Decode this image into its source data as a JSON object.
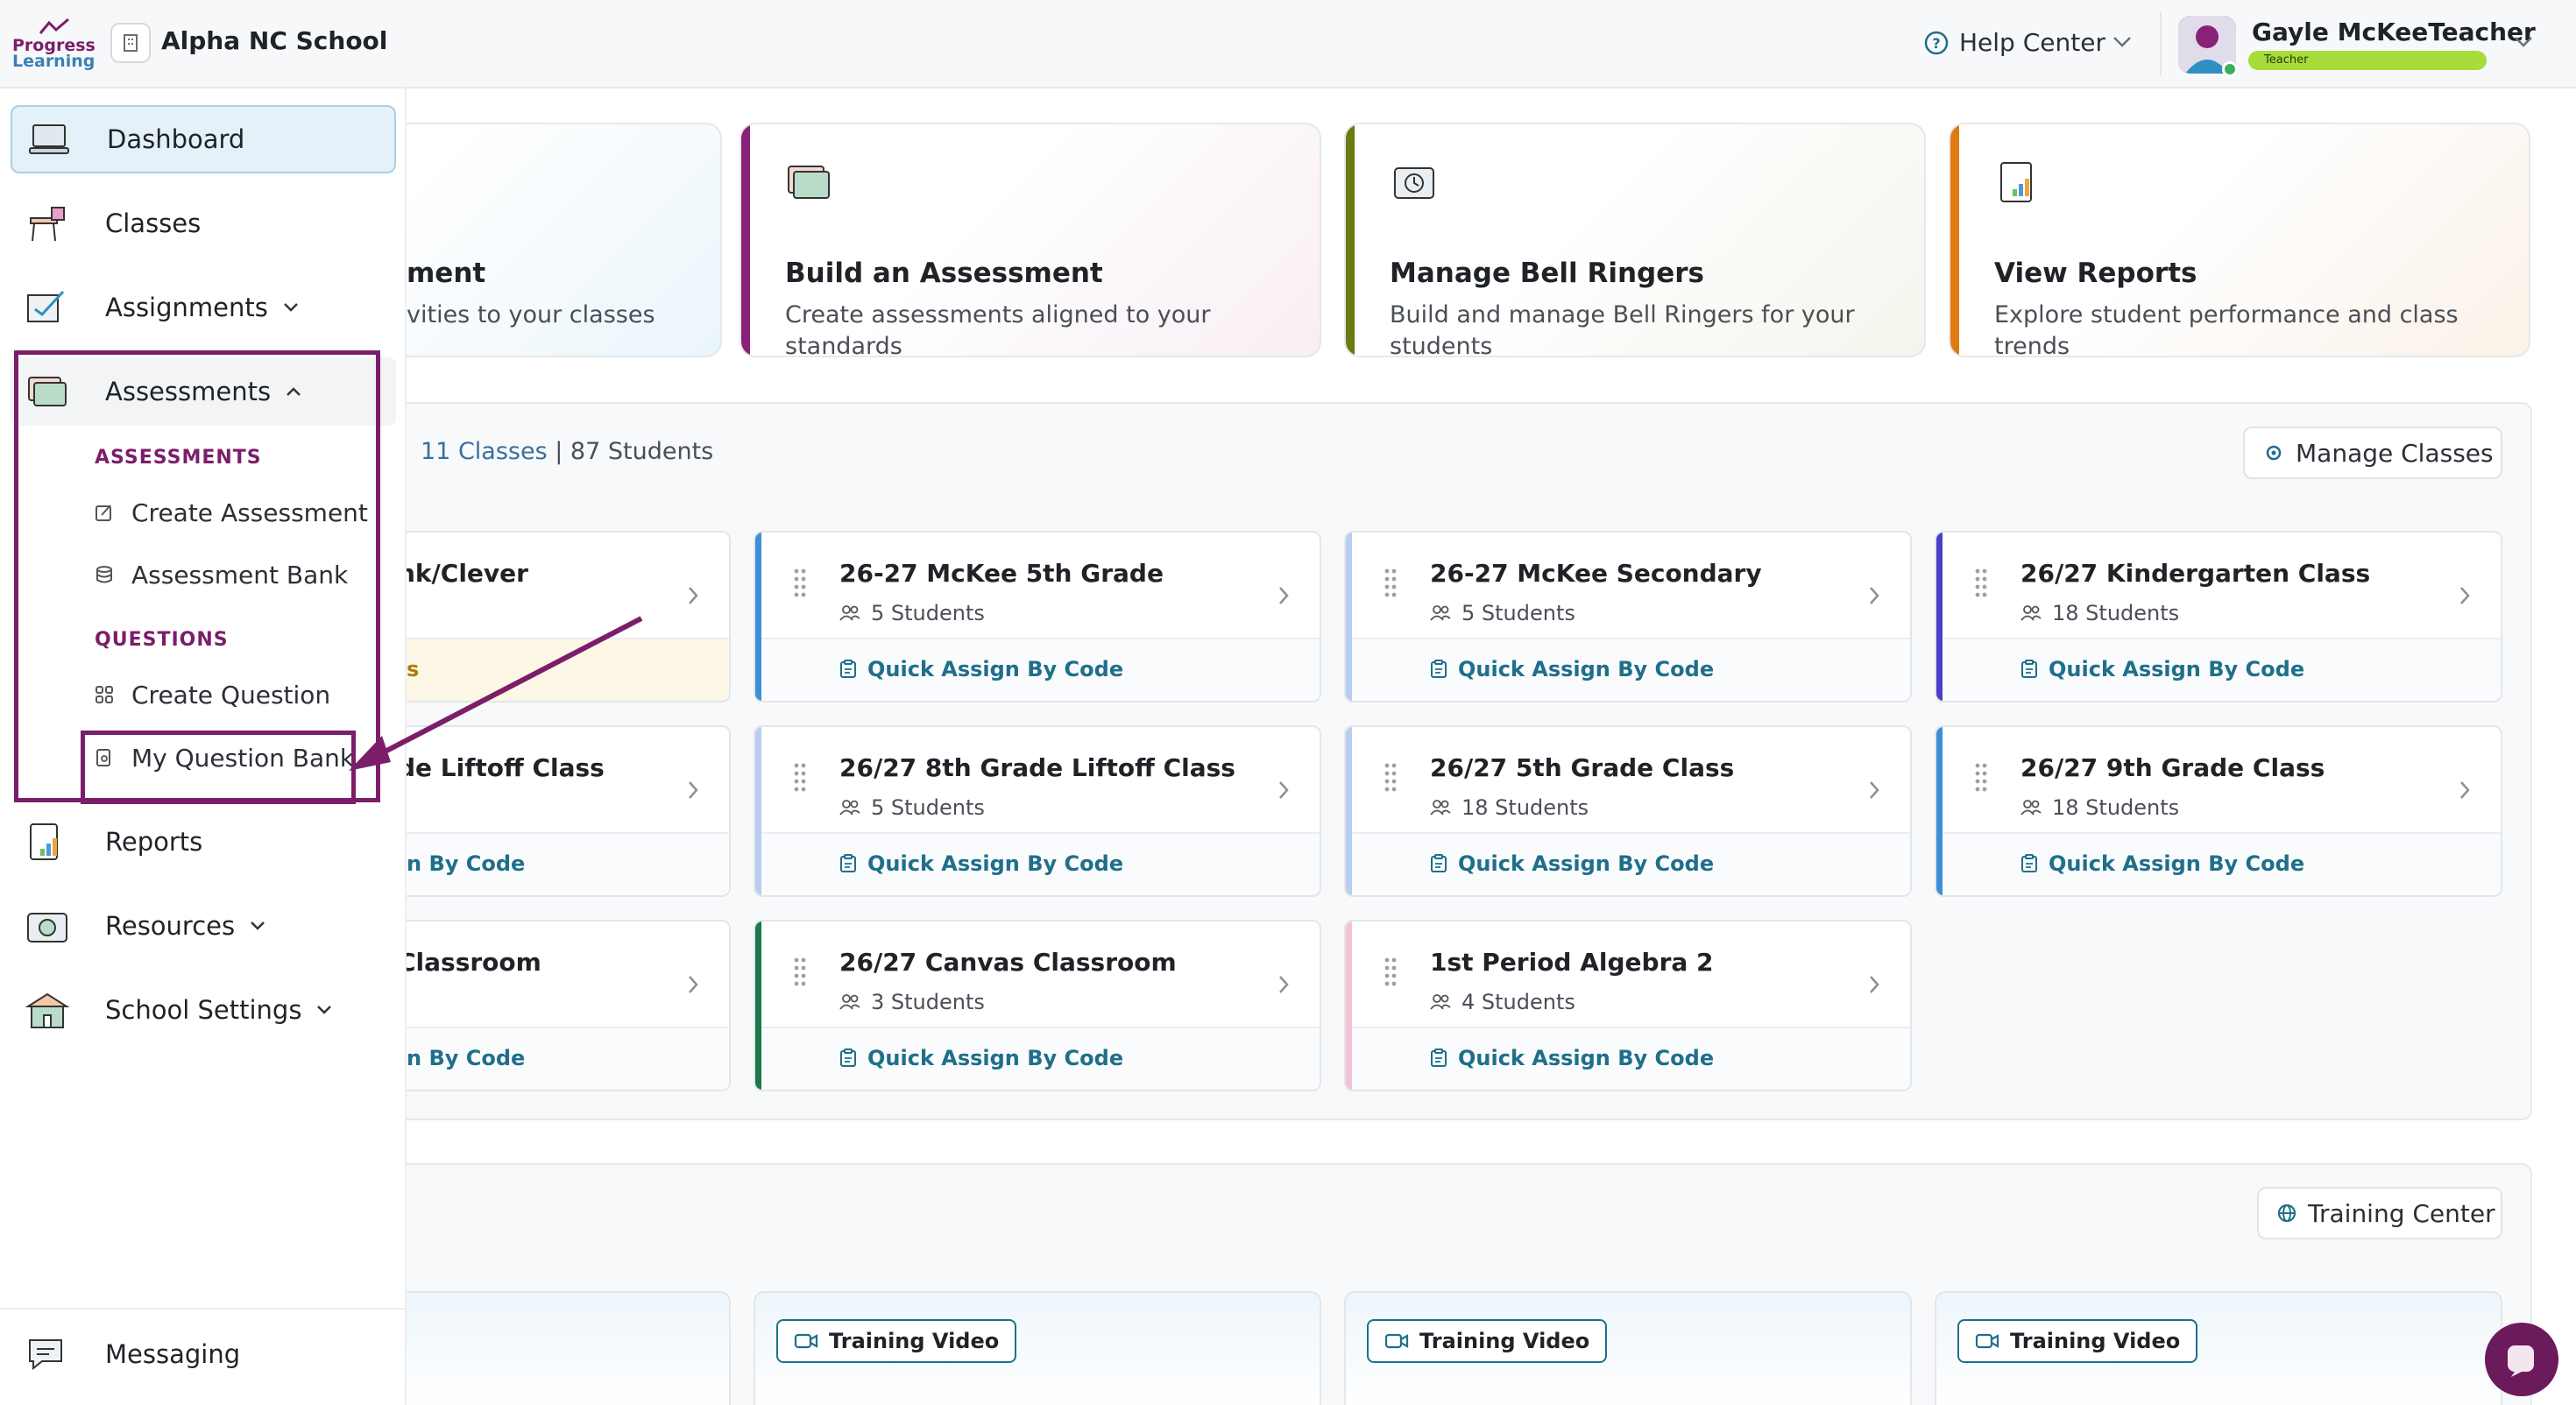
{
  "brand": {
    "logo_line1": "Progress",
    "logo_line2": "Learning",
    "school_name": "Alpha NC School"
  },
  "header": {
    "help_label": "Help Center",
    "user_name": "Gayle McKeeTeacher",
    "user_role": "Teacher"
  },
  "sidebar": {
    "items": [
      {
        "label": "Dashboard"
      },
      {
        "label": "Classes"
      },
      {
        "label": "Assignments"
      },
      {
        "label": "Assessments"
      },
      {
        "label": "Reports"
      },
      {
        "label": "Resources"
      },
      {
        "label": "School Settings"
      }
    ],
    "assessments_submenu": {
      "assessments_heading": "ASSESSMENTS",
      "create_assessment": "Create Assessment",
      "assessment_bank": "Assessment Bank",
      "questions_heading": "QUESTIONS",
      "create_question": "Create Question",
      "my_question_bank": "My Question Bank"
    },
    "messaging": "Messaging"
  },
  "actions": [
    {
      "title": "ment",
      "desc": "vities to your classes",
      "accent": "#2f8fc4"
    },
    {
      "title": "Build an Assessment",
      "desc": "Create assessments aligned to your standards",
      "accent": "#8a2178"
    },
    {
      "title": "Manage Bell Ringers",
      "desc": "Build and manage Bell Ringers for your students",
      "accent": "#6c7a12"
    },
    {
      "title": "View Reports",
      "desc": "Explore student performance and class trends",
      "accent": "#e27a12"
    }
  ],
  "classes": {
    "count_label": "11 Classes",
    "students_label": "| 87 Students",
    "manage_button": "Manage Classes",
    "partial": [
      {
        "name": "nk/Clever",
        "link": "s"
      },
      {
        "name": "de Liftoff Class",
        "link": "n By Code"
      },
      {
        "name": "Classroom",
        "link": "n By Code"
      }
    ],
    "cards": [
      {
        "name": "26-27 McKee 5th Grade",
        "students": "5 Students",
        "link": "Quick Assign By Code",
        "color": "#3f8fd6"
      },
      {
        "name": "26-27 McKee Secondary",
        "students": "5 Students",
        "link": "Quick Assign By Code",
        "color": "#b9cdf0"
      },
      {
        "name": "26/27 Kindergarten Class",
        "students": "18 Students",
        "link": "Quick Assign By Code",
        "color": "#4b3fc8"
      },
      {
        "name": "26/27 8th Grade Liftoff Class",
        "students": "5 Students",
        "link": "Quick Assign By Code",
        "color": "#b9cdf0"
      },
      {
        "name": "26/27 5th Grade Class",
        "students": "18 Students",
        "link": "Quick Assign By Code",
        "color": "#b9cdf0"
      },
      {
        "name": "26/27 9th Grade Class",
        "students": "18 Students",
        "link": "Quick Assign By Code",
        "color": "#3f8fd6"
      },
      {
        "name": "26/27 Canvas Classroom",
        "students": "3 Students",
        "link": "Quick Assign By Code",
        "color": "#1c7a4a"
      },
      {
        "name": "1st Period Algebra 2",
        "students": "4 Students",
        "link": "Quick Assign By Code",
        "color": "#f4c2d6"
      }
    ]
  },
  "training": {
    "center_button": "Training Center",
    "tags": [
      "Training Video",
      "Training Video",
      "Training Video"
    ]
  },
  "colors": {
    "brand_purple": "#7b1e6a",
    "link_teal": "#1f6f8b",
    "active_nav": "#e4f1f9"
  }
}
